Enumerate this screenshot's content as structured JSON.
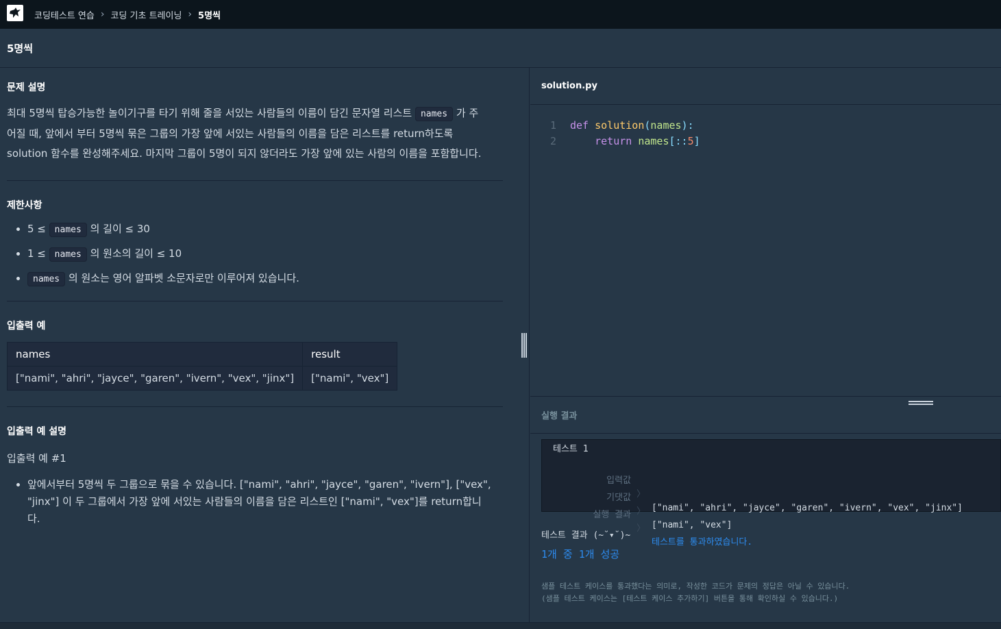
{
  "breadcrumb": {
    "items": [
      "코딩테스트 연습",
      "코딩 기초 트레이닝"
    ],
    "current": "5명씩"
  },
  "page_title": "5명씩",
  "problem": {
    "heading": "문제 설명",
    "desc_part1": "최대 5명씩 탑승가능한 놀이기구를 타기 위해 줄을 서있는 사람들의 이름이 담긴 문자열 리스트",
    "desc_code": "names",
    "desc_part2": "가 주",
    "desc_line2": "어질 때, 앞에서 부터 5명씩 묶은 그룹의 가장 앞에 서있는 사람들의 이름을 담은 리스트를 return하도록",
    "desc_line3": "solution 함수를 완성해주세요. 마지막 그룹이 5명이 되지 않더라도 가장 앞에 있는 사람의 이름을 포함합니다."
  },
  "constraints": {
    "heading": "제한사항",
    "items": [
      {
        "pre": "5 ≤",
        "code": "names",
        "post": "의 길이 ≤ 30"
      },
      {
        "pre": "1 ≤",
        "code": "names",
        "post": "의 원소의 길이 ≤ 10"
      },
      {
        "pre": "",
        "code": "names",
        "post": "의 원소는 영어 알파벳 소문자로만 이루어져 있습니다."
      }
    ]
  },
  "io_example": {
    "heading": "입출력 예",
    "columns": [
      "names",
      "result"
    ],
    "rows": [
      [
        "[\"nami\", \"ahri\", \"jayce\", \"garen\", \"ivern\", \"vex\", \"jinx\"]",
        "[\"nami\", \"vex\"]"
      ]
    ]
  },
  "io_explain": {
    "heading": "입출력 예 설명",
    "sub": "입출력 예 #1",
    "line1": "앞에서부터 5명씩 두 그룹으로 묶을 수 있습니다. [\"nami\", \"ahri\", \"jayce\", \"garen\", \"ivern\"], [\"vex\",",
    "line2": "\"jinx\"] 이 두 그룹에서 가장 앞에 서있는 사람들의 이름을 담은 리스트인 [\"nami\", \"vex\"]를 return합니",
    "line3": "다."
  },
  "editor": {
    "filename": "solution.py",
    "lines": [
      {
        "num": "1",
        "kw": "def",
        "fn": "solution",
        "p1": "(",
        "arg": "names",
        "p2": "):"
      },
      {
        "num": "2",
        "kw": "return",
        "arg": "names",
        "p1": "[::",
        "num_lit": "5",
        "p2": "]"
      }
    ]
  },
  "results": {
    "heading": "실행 결과",
    "test_title": "테스트 1",
    "input_label": "입력값",
    "input_value": "[\"nami\", \"ahri\", \"jayce\", \"garen\", \"ivern\", \"vex\", \"jinx\"]",
    "expected_label": "기댓값",
    "expected_value": "[\"nami\", \"vex\"]",
    "run_label": "실행 결과",
    "run_value": "테스트를 통과하였습니다.",
    "arrow": "〉",
    "summary_label": "테스트 결과 (~˘▾˘)~",
    "summary_value": "1개 중 1개 성공",
    "note1": "샘플 테스트 케이스를 통과했다는 의미로, 작성한 코드가 문제의 정답은 아닐 수 있습니다.",
    "note2": "(샘플 테스트 케이스는 [테스트 케이스 추가하기] 버튼을 통해 확인하실 수 있습니다.)"
  },
  "colors": {
    "background": "#263747",
    "topbar": "#0c151c",
    "accent": "#2d8cf0"
  },
  "icons": [
    "logo-icon",
    "chevron-right-icon",
    "vertical-resize-icon",
    "horizontal-resize-icon"
  ]
}
